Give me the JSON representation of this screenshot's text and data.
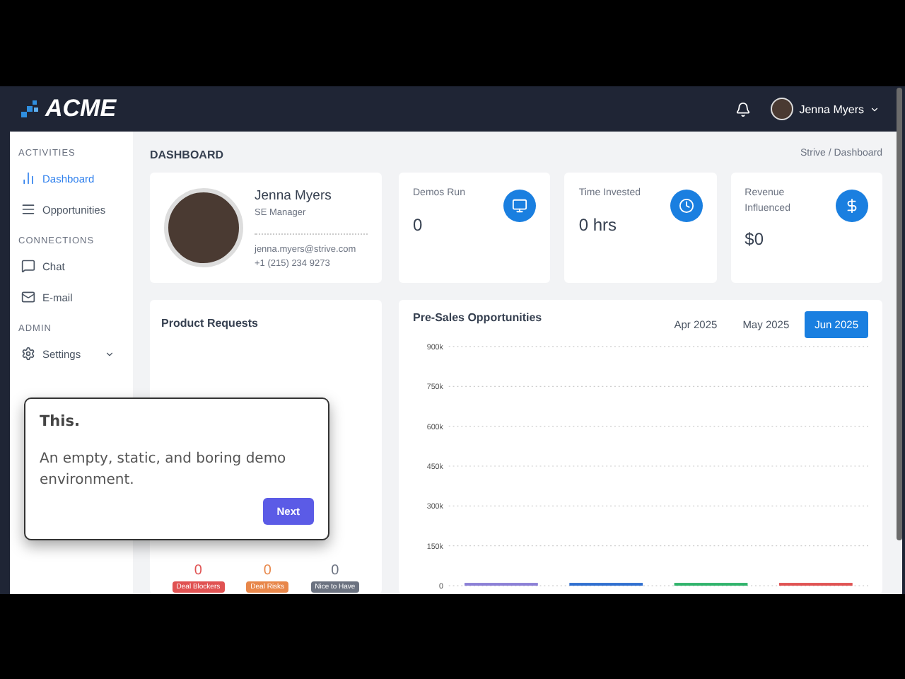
{
  "header": {
    "logo": "ACME",
    "user": {
      "name": "Jenna Myers"
    }
  },
  "sidebar": {
    "sections": [
      {
        "title": "ACTIVITIES",
        "items": [
          {
            "label": "Dashboard",
            "selected": true
          },
          {
            "label": "Opportunities",
            "selected": false
          }
        ]
      },
      {
        "title": "CONNECTIONS",
        "items": [
          {
            "label": "Chat",
            "selected": false
          },
          {
            "label": "E-mail",
            "selected": false
          }
        ]
      },
      {
        "title": "ADMIN",
        "items": [
          {
            "label": "Settings",
            "selected": false,
            "expanded": false
          }
        ]
      }
    ]
  },
  "page": {
    "title": "DASHBOARD",
    "breadcrumb": "Strive / Dashboard"
  },
  "profile": {
    "name": "Jenna Myers",
    "role": "SE Manager",
    "email": "jenna.myers@strive.com",
    "phone": "+1 (215) 234 9273"
  },
  "stats": [
    {
      "label": "Demos Run",
      "value": "0"
    },
    {
      "label": "Time Invested",
      "value": "0 hrs"
    },
    {
      "label": "Revenue Influenced",
      "value": "$0"
    }
  ],
  "product_requests": {
    "title": "Product Requests",
    "counts": [
      {
        "value": "0",
        "label": "Deal Blockers",
        "color": "#e05252"
      },
      {
        "value": "0",
        "label": "Deal Risks",
        "color": "#e8874a"
      },
      {
        "value": "0",
        "label": "Nice to Have",
        "color": "#6b7280"
      }
    ]
  },
  "opportunities": {
    "title": "Pre-Sales Opportunities",
    "periods": [
      {
        "label": "Apr 2025",
        "selected": false
      },
      {
        "label": "May 2025",
        "selected": false
      },
      {
        "label": "Jun 2025",
        "selected": true
      }
    ],
    "chart_data": {
      "type": "bar",
      "grid": true,
      "ylim": [
        0,
        900000
      ],
      "yticks": [
        {
          "value": 0,
          "label": "0"
        },
        {
          "value": 150000,
          "label": "150k"
        },
        {
          "value": 300000,
          "label": "300k"
        },
        {
          "value": 450000,
          "label": "450k"
        },
        {
          "value": 600000,
          "label": "600k"
        },
        {
          "value": 750000,
          "label": "750k"
        },
        {
          "value": 900000,
          "label": "900k"
        }
      ],
      "series": [
        {
          "color": "#8b7fd6",
          "values": [
            0
          ]
        },
        {
          "color": "#2f6fd0",
          "values": [
            0
          ]
        },
        {
          "color": "#2fb36b",
          "values": [
            0
          ]
        },
        {
          "color": "#e05252",
          "values": [
            0
          ]
        }
      ]
    }
  },
  "tour": {
    "title": "This.",
    "body": "An empty, static, and boring demo environment.",
    "button": "Next"
  }
}
